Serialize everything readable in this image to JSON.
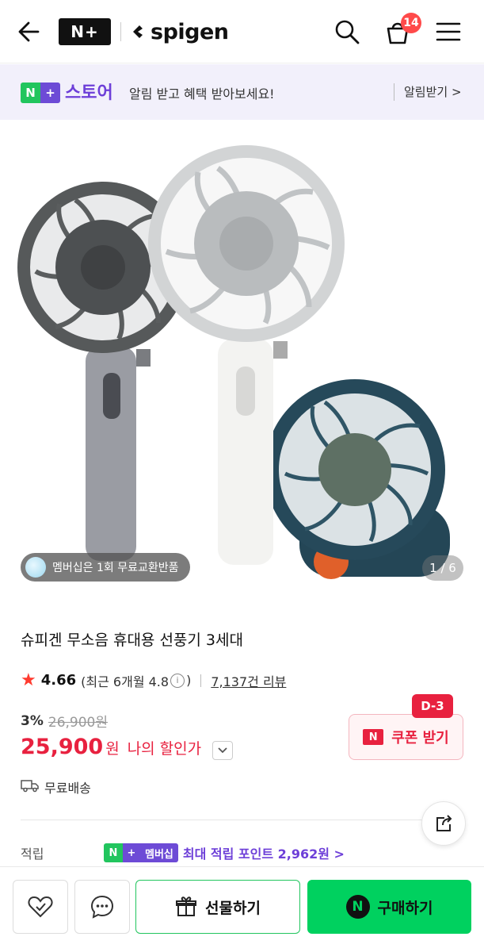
{
  "header": {
    "badge": "N+",
    "brand": "spigen",
    "cart_count": "14",
    "icons": [
      "back-arrow-icon",
      "search-icon",
      "cart-icon",
      "menu-icon"
    ]
  },
  "promo": {
    "badge_n": "N",
    "badge_plus": "+",
    "store": "스토어",
    "message": "알림 받고 혜택 받아보세요!",
    "notify": "알림받기 >"
  },
  "hero": {
    "chip": "멤버십은 1회 무료교환반품",
    "pager": "1 / 6"
  },
  "product": {
    "title": "슈피겐 무소음 휴대용 선풍기 3세대",
    "score": "4.66",
    "recent": "(최근 6개월 4.8",
    "recent_end": ")",
    "reviews": "7,137건 리뷰",
    "discount_pct": "3%",
    "original_price": "26,900원",
    "price": "25,900",
    "won": "원",
    "my_discount": "나의 할인가",
    "shipping": "무료배송"
  },
  "coupon": {
    "dday": "D-3",
    "logo": "N",
    "label": "쿠폰 받기"
  },
  "points": {
    "label": "적립",
    "badge_n": "N",
    "badge_plus": "+",
    "badge_text": "멤버십",
    "text": "최대 적립 포인트 2,962원 >"
  },
  "bottom": {
    "gift": "선물하기",
    "buy_logo": "N",
    "buy": "구매하기"
  },
  "colors": {
    "accent_green": "#00d15f",
    "accent_purple": "#6d3fd8",
    "price_red": "#e8213f"
  }
}
